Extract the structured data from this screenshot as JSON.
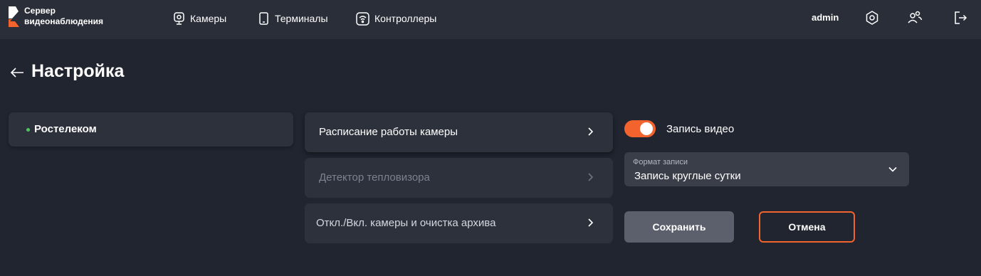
{
  "header": {
    "logo_line1": "Сервер",
    "logo_line2": "видеонаблюдения",
    "nav": [
      {
        "label": "Камеры",
        "icon": "camera-icon"
      },
      {
        "label": "Терминалы",
        "icon": "terminal-icon"
      },
      {
        "label": "Контроллеры",
        "icon": "controller-icon"
      }
    ],
    "user": "admin",
    "icons": [
      "settings-gear-icon",
      "users-icon",
      "logout-icon"
    ]
  },
  "page": {
    "title": "Настройка",
    "back_icon": "arrow-left-icon"
  },
  "sidebar": {
    "org_name": "Ростелеком",
    "status_color": "#4cc95a"
  },
  "menu": {
    "items": [
      {
        "label": "Расписание работы камеры",
        "state": "active"
      },
      {
        "label": "Детектор тепловизора",
        "state": "disabled"
      },
      {
        "label": "Откл./Вкл. камеры и очистка архива",
        "state": "normal"
      }
    ]
  },
  "recording": {
    "toggle_label": "Запись видео",
    "toggle_on": true,
    "format_caption": "Формат записи",
    "format_value": "Запись круглые сутки"
  },
  "actions": {
    "save_label": "Сохранить",
    "cancel_label": "Отмена"
  },
  "colors": {
    "accent": "#f2632d",
    "background": "#212530",
    "header": "#2a2e38",
    "card": "#2d313c"
  }
}
